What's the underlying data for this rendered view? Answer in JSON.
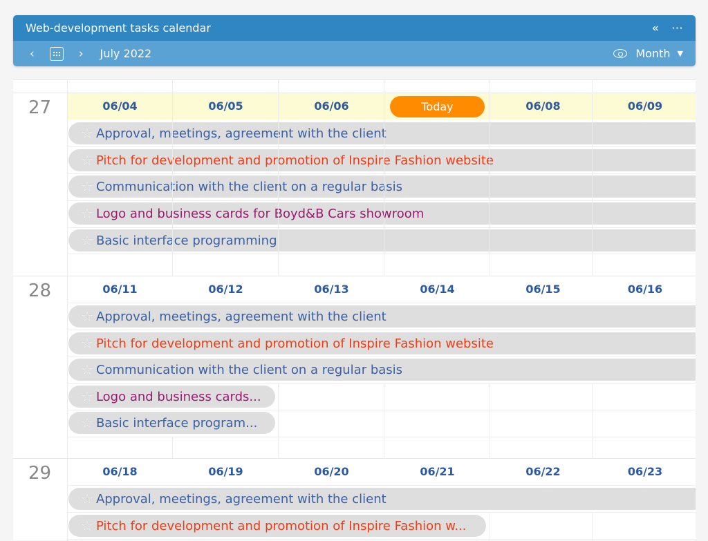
{
  "header": {
    "title": "Web-development tasks calendar",
    "collapse_icon": "«",
    "more_icon": "⋯",
    "prev_icon": "‹",
    "next_icon": "›",
    "month_label": "July 2022",
    "view_label": "Month",
    "caret_icon": "▼"
  },
  "tasks": {
    "t1": "Approval, meetings, agreement with the client",
    "t2": "Pitch for development and promotion of Inspire Fashion website",
    "t2_short": "Pitch for development and promotion of Inspire Fashion w...",
    "t3": "Communication with the client on a regular basis",
    "t4": "Logo and business cards for Boyd&B Cars showroom",
    "t4_short": "Logo and business cards...",
    "t5": "Basic interface programming",
    "t5_short": "Basic interface program..."
  },
  "weeks": [
    {
      "number": "27",
      "dates": [
        "06/04",
        "06/05",
        "06/06",
        "Today",
        "06/08",
        "06/09"
      ]
    },
    {
      "number": "28",
      "dates": [
        "06/11",
        "06/12",
        "06/13",
        "06/14",
        "06/15",
        "06/16"
      ]
    },
    {
      "number": "29",
      "dates": [
        "06/18",
        "06/19",
        "06/20",
        "06/21",
        "06/22",
        "06/23"
      ]
    }
  ],
  "colors": {
    "header": "#2f86c3",
    "nav": "#5aa2d3",
    "today": "#ff8c00",
    "blue": "#3a5fa2",
    "red": "#f03c14",
    "purple": "#9a1a6e"
  },
  "star_icon": "☆"
}
